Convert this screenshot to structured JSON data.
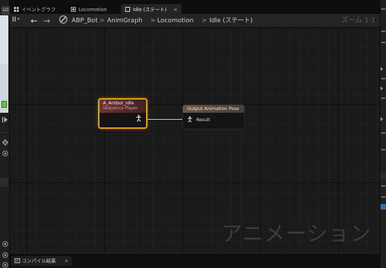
{
  "left_panel": {
    "tab_label": "LO",
    "icons": [
      "play-icon",
      "gear-icon",
      "target-icon",
      "target-icon",
      "target-icon"
    ]
  },
  "tabs": [
    {
      "label": "イベントグラフ",
      "icon": "graph-icon",
      "active": false
    },
    {
      "label": "Locomotion",
      "icon": "state-machine-icon",
      "active": false
    },
    {
      "label": "Idle (ステート)",
      "icon": "state-icon",
      "active": true,
      "close": "×"
    }
  ],
  "breadcrumb": {
    "nav_back": "←",
    "nav_forward": "→",
    "asset": "ABP_Bot",
    "items": [
      "AnimGraph",
      "Locomotion",
      "Idle (ステート)"
    ],
    "separator": ">",
    "zoom": "ズーム 1:1"
  },
  "graph": {
    "watermark": "アニメーション",
    "sequence_node": {
      "title": "A_Antbot_Idle",
      "subtitle": "Sequence Player"
    },
    "output_node": {
      "title": "Output Animation Pose",
      "pin": "Result"
    }
  },
  "bottom": {
    "tab_label": "コンパイル結果",
    "close": "×"
  },
  "colors": {
    "graph_bg": "#1a1a1a",
    "selected_outline": "#e8a21a",
    "sequence_header": "#6e3535",
    "output_header": "#6b5647"
  }
}
